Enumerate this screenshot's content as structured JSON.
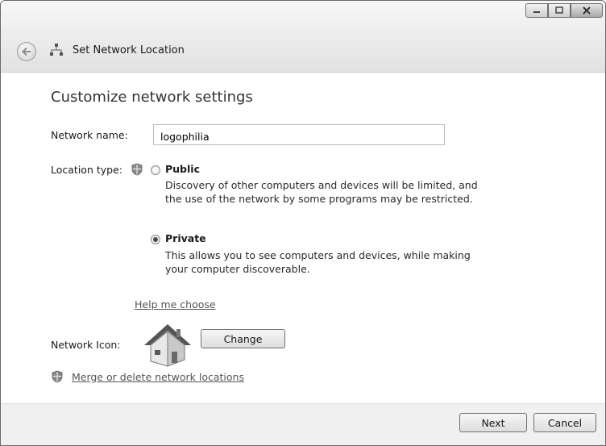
{
  "window": {
    "title": "Set Network Location"
  },
  "page": {
    "heading": "Customize network settings"
  },
  "network_name": {
    "label": "Network name:",
    "value": "logophilia"
  },
  "location": {
    "label": "Location type:",
    "public": {
      "title": "Public",
      "line1": "Discovery of other computers and devices will be limited, and",
      "line2": "the use of the network by some programs may be restricted.",
      "selected": false
    },
    "private": {
      "title": "Private",
      "line1": "This allows you to see computers and devices, while making",
      "line2": "your computer discoverable.",
      "selected": true
    }
  },
  "help_link": "Help me choose",
  "network_icon": {
    "label": "Network Icon:",
    "change_label": "Change"
  },
  "merge_link": "Merge or delete network locations",
  "footer": {
    "next_label": "Next",
    "cancel_label": "Cancel"
  },
  "icons": [
    "back-arrow-icon",
    "network-icon",
    "minimize-icon",
    "maximize-icon",
    "close-icon",
    "shield-icon",
    "house-icon"
  ]
}
